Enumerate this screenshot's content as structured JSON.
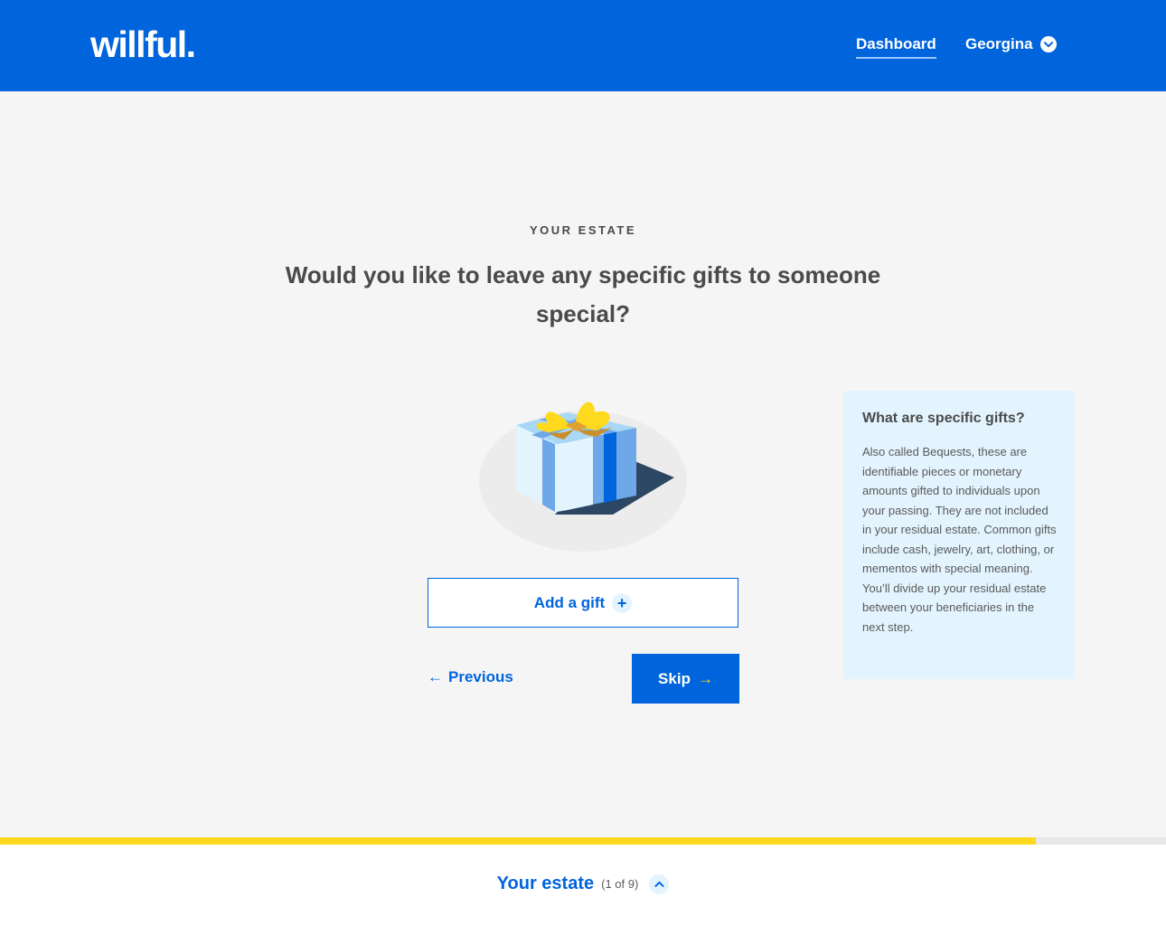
{
  "header": {
    "logo": "willful.",
    "nav_dashboard": "Dashboard",
    "user_name": "Georgina",
    "brand_color": "#0064dc"
  },
  "main": {
    "eyebrow": "YOUR ESTATE",
    "question": "Would you like to leave any specific gifts to someone special?",
    "add_gift_label": "Add a gift",
    "add_gift_icon": "+",
    "previous_label": "Previous",
    "previous_icon": "←",
    "skip_label": "Skip",
    "skip_icon": "→",
    "illustration": "gift-box-icon"
  },
  "info_panel": {
    "title": "What are specific gifts?",
    "body": "Also called Bequests, these are identifiable pieces or monetary amounts gifted to individuals upon your passing. They are not included in your residual estate. Common gifts include cash, jewelry, art, clothing, or mementos with special meaning. You’ll divide up your residual estate between your beneficiaries in the next step."
  },
  "progress": {
    "percent": 88.8,
    "fill_color": "#ffd91e"
  },
  "footer": {
    "section_title": "Your estate",
    "section_count": "(1 of 9)"
  }
}
